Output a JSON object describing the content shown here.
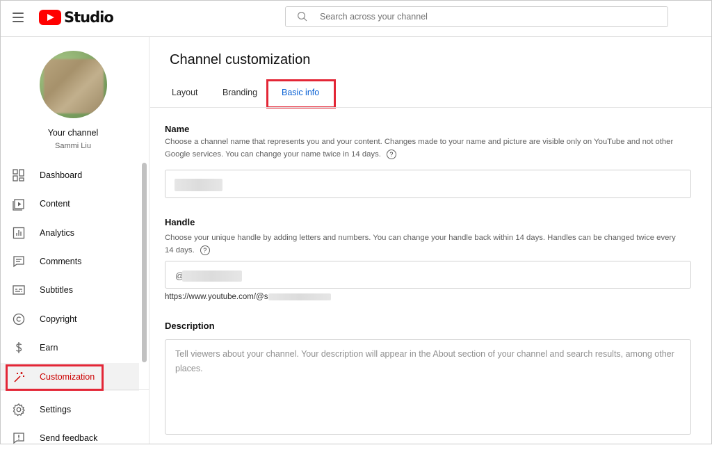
{
  "header": {
    "app_name": "Studio",
    "search_placeholder": "Search across your channel"
  },
  "sidebar": {
    "channel_title": "Your channel",
    "channel_name": "Sammi Liu",
    "items": [
      {
        "label": "Dashboard",
        "icon": "dashboard-icon"
      },
      {
        "label": "Content",
        "icon": "content-icon"
      },
      {
        "label": "Analytics",
        "icon": "analytics-icon"
      },
      {
        "label": "Comments",
        "icon": "comments-icon"
      },
      {
        "label": "Subtitles",
        "icon": "subtitles-icon"
      },
      {
        "label": "Copyright",
        "icon": "copyright-icon"
      },
      {
        "label": "Earn",
        "icon": "earn-icon"
      },
      {
        "label": "Customization",
        "icon": "magic-wand-icon",
        "active": true
      },
      {
        "label": "Settings",
        "icon": "gear-icon"
      },
      {
        "label": "Send feedback",
        "icon": "feedback-icon"
      }
    ]
  },
  "main": {
    "title": "Channel customization",
    "tabs": [
      {
        "label": "Layout"
      },
      {
        "label": "Branding"
      },
      {
        "label": "Basic info",
        "active": true
      }
    ],
    "name_section": {
      "title": "Name",
      "description": "Choose a channel name that represents you and your content. Changes made to your name and picture are visible only on YouTube and not other Google services. You can change your name twice in 14 days.",
      "help": "?"
    },
    "handle_section": {
      "title": "Handle",
      "description": "Choose your unique handle by adding letters and numbers. You can change your handle back within 14 days. Handles can be changed twice every 14 days.",
      "help": "?",
      "prefix": "@",
      "url_prefix": "https://www.youtube.com/@s"
    },
    "description_section": {
      "title": "Description",
      "placeholder": "Tell viewers about your channel. Your description will appear in the About section of your channel and search results, among other places."
    }
  },
  "colors": {
    "brand_red": "#ff0000",
    "active_text": "#cc0000",
    "tab_active": "#065fd4",
    "highlight": "#e32636"
  }
}
